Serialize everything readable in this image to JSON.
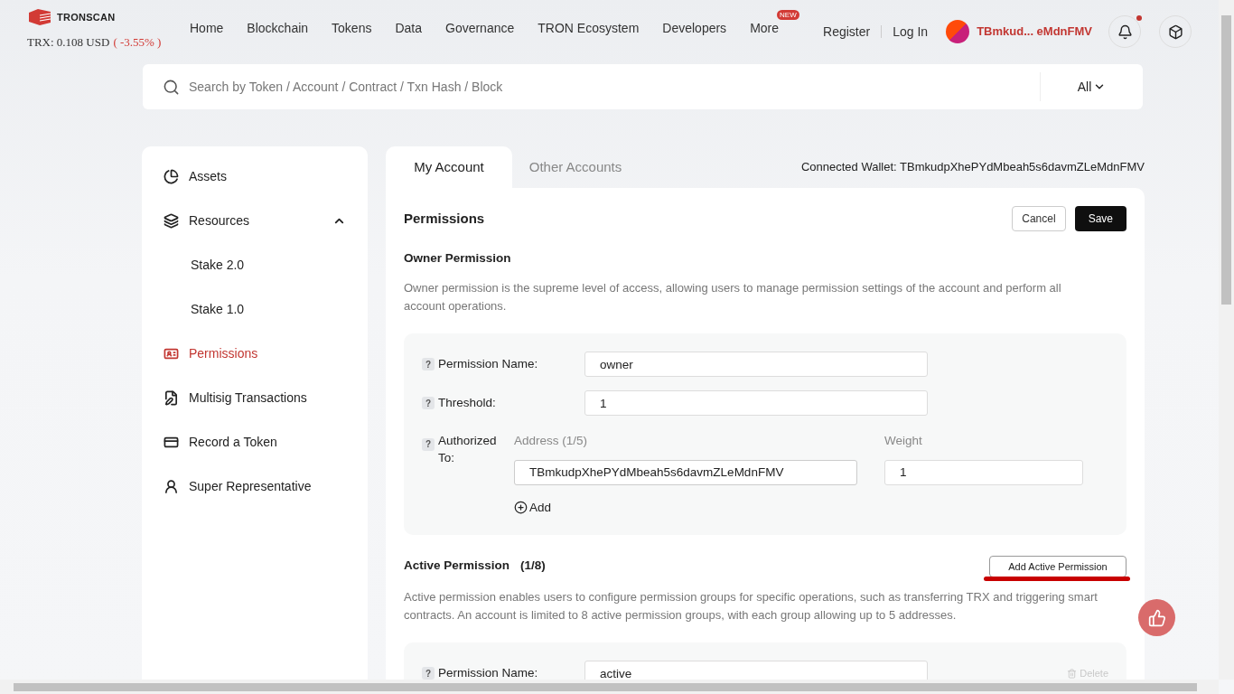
{
  "header": {
    "brand": "TRONSCAN",
    "price": "TRX: 0.108 USD",
    "change": "( -3.55% )",
    "nav": [
      {
        "label": "Home"
      },
      {
        "label": "Blockchain"
      },
      {
        "label": "Tokens"
      },
      {
        "label": "Data"
      },
      {
        "label": "Governance"
      },
      {
        "label": "TRON Ecosystem"
      },
      {
        "label": "Developers"
      },
      {
        "label": "More",
        "badge": "NEW"
      }
    ],
    "register": "Register",
    "login": "Log In",
    "account": "TBmkud... eMdnFMV",
    "notification_unread": true
  },
  "search": {
    "placeholder": "Search by Token / Account / Contract / Txn Hash / Block",
    "filter": "All"
  },
  "sidebar": {
    "items": [
      {
        "label": "Assets",
        "selected": false
      },
      {
        "label": "Resources",
        "selected": false,
        "expanded": true,
        "children": [
          {
            "label": "Stake 2.0",
            "selected": false
          },
          {
            "label": "Stake 1.0",
            "selected": false
          }
        ]
      },
      {
        "label": "Permissions",
        "selected": true
      },
      {
        "label": "Multisig Transactions",
        "selected": false
      },
      {
        "label": "Record a Token",
        "selected": false
      },
      {
        "label": "Super Representative",
        "selected": false
      }
    ]
  },
  "tabs": [
    {
      "label": "My Account",
      "selected": true
    },
    {
      "label": "Other Accounts",
      "selected": false
    }
  ],
  "connected_wallet": "Connected Wallet: TBmkudpXhePYdMbeah5s6davmZLeMdnFMV",
  "permissions": {
    "title": "Permissions",
    "cancel": "Cancel",
    "save": "Save",
    "owner": {
      "heading": "Owner Permission",
      "description": "Owner permission is the supreme level of access, allowing users to manage permission settings of the account and perform all account operations.",
      "help": "?",
      "name_label": "Permission Name:",
      "name_value": "owner",
      "threshold_label": "Threshold:",
      "threshold_value": "1",
      "authorized_label": "Authorized To:",
      "address_header": "Address (1/5)",
      "weight_header": "Weight",
      "address_value": "TBmkudpXhePYdMbeah5s6davmZLeMdnFMV",
      "weight_value": "1",
      "add": "Add"
    },
    "active": {
      "heading": "Active Permission",
      "count": "(1/8)",
      "add_button": "Add Active Permission",
      "description": "Active permission enables users to configure permission groups for specific operations, such as transferring TRX and triggering smart contracts. An account is limited to 8 active permission groups, with each group allowing up to 5 addresses.",
      "help": "?",
      "name_label": "Permission Name:",
      "name_value": "active",
      "delete": "Delete"
    }
  }
}
